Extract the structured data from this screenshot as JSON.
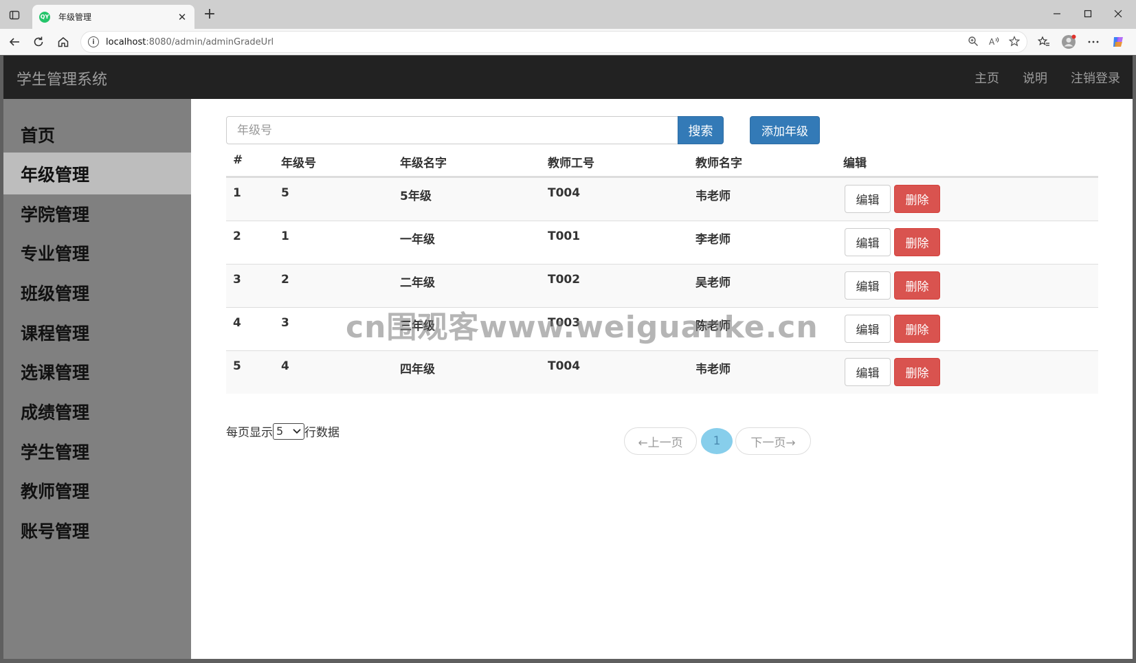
{
  "browser": {
    "tab_title": "年级管理",
    "favicon_text": "QY",
    "url_host": "localhost",
    "url_path": ":8080/admin/adminGradeUrl"
  },
  "app": {
    "brand": "学生管理系统",
    "topnav": [
      "主页",
      "说明",
      "注销登录"
    ]
  },
  "sidebar": {
    "items": [
      {
        "label": "首页",
        "active": false
      },
      {
        "label": "年级管理",
        "active": true
      },
      {
        "label": "学院管理",
        "active": false
      },
      {
        "label": "专业管理",
        "active": false
      },
      {
        "label": "班级管理",
        "active": false
      },
      {
        "label": "课程管理",
        "active": false
      },
      {
        "label": "选课管理",
        "active": false
      },
      {
        "label": "成绩管理",
        "active": false
      },
      {
        "label": "学生管理",
        "active": false
      },
      {
        "label": "教师管理",
        "active": false
      },
      {
        "label": "账号管理",
        "active": false
      }
    ]
  },
  "search": {
    "placeholder": "年级号",
    "value": "",
    "button_label": "搜索"
  },
  "add_button_label": "添加年级",
  "table": {
    "headers": [
      "#",
      "年级号",
      "年级名字",
      "教师工号",
      "教师名字",
      "编辑"
    ],
    "rows": [
      [
        "1",
        "5",
        "5年级",
        "T004",
        "韦老师"
      ],
      [
        "2",
        "1",
        "一年级",
        "T001",
        "李老师"
      ],
      [
        "3",
        "2",
        "二年级",
        "T002",
        "吴老师"
      ],
      [
        "4",
        "3",
        "三年级",
        "T003",
        "陈老师"
      ],
      [
        "5",
        "4",
        "四年级",
        "T004",
        "韦老师"
      ]
    ],
    "edit_label": "编辑",
    "delete_label": "删除"
  },
  "pagination": {
    "per_page_prefix": "每页显示",
    "per_page_value": "5",
    "per_page_suffix": "行数据",
    "prev_label": "←上一页",
    "current_page": "1",
    "next_label": "下一页→"
  },
  "watermark": "cn围观客www.weiguanke.cn",
  "colors": {
    "primary": "#337ab7",
    "danger": "#d9534f",
    "navbar": "#222222",
    "sidebar": "#808080",
    "sidebar_active": "#bdbdbd",
    "page_active": "#87ceeb"
  }
}
